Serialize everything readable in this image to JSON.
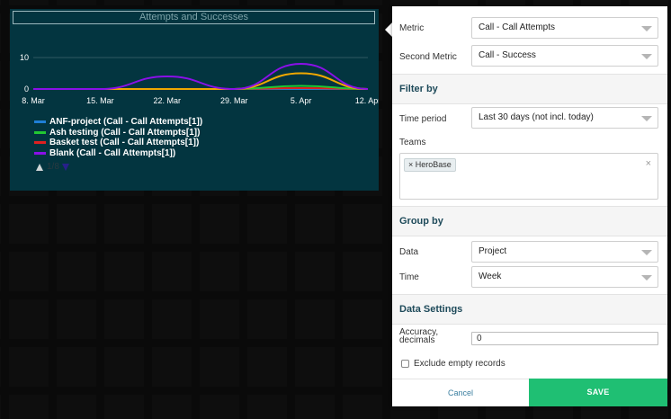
{
  "chart_widget": {
    "title": "Attempts and Successes",
    "pager_text": "1/8"
  },
  "chart_data": {
    "type": "line",
    "title": "Attempts and Successes",
    "x": [
      "8. Mar",
      "15. Mar",
      "22. Mar",
      "29. Mar",
      "5. Apr",
      "12. Apr"
    ],
    "x_dates": [
      "2021-03-08",
      "2021-03-15",
      "2021-03-22",
      "2021-03-29",
      "2021-04-05",
      "2021-04-12"
    ],
    "yticks": [
      "0",
      "10"
    ],
    "ylim": [
      0,
      14
    ],
    "grid": "horizontal",
    "series": [
      {
        "name": "ANF-project (Call - Call Attempts[1])",
        "color": "#1f7fd6",
        "points": [
          [
            0,
            0
          ],
          [
            1,
            0
          ],
          [
            2,
            0
          ],
          [
            3,
            0
          ],
          [
            4,
            0
          ],
          [
            5,
            0
          ]
        ]
      },
      {
        "name": "Ash testing (Call - Call Attempts[1])",
        "color": "#22c832",
        "points": [
          [
            0,
            0
          ],
          [
            1,
            0
          ],
          [
            2,
            0
          ],
          [
            3,
            0
          ],
          [
            4,
            1
          ],
          [
            5,
            0
          ]
        ]
      },
      {
        "name": "Basket test (Call - Call Attempts[1])",
        "color": "#e02020",
        "points": [
          [
            0,
            0
          ],
          [
            1,
            0
          ],
          [
            2,
            0
          ],
          [
            3,
            0
          ],
          [
            4,
            0.3
          ],
          [
            5,
            0
          ]
        ]
      },
      {
        "name": "Blank (Call - Call Attempts[1])",
        "color": "#8a10e8",
        "points": [
          [
            0,
            0
          ],
          [
            1,
            0
          ],
          [
            2,
            4
          ],
          [
            3,
            0
          ],
          [
            4,
            8
          ],
          [
            5,
            0
          ]
        ]
      },
      {
        "name": "",
        "color": "#f0a800",
        "points": [
          [
            0,
            0
          ],
          [
            1,
            0
          ],
          [
            2,
            0
          ],
          [
            3,
            0
          ],
          [
            4,
            5
          ],
          [
            5,
            0
          ]
        ]
      }
    ],
    "legend_placement": "bottom-left"
  },
  "panel": {
    "metric_label": "Metric",
    "metric_value": "Call - Call Attempts",
    "second_metric_label": "Second Metric",
    "second_metric_value": "Call - Success",
    "filter_by_title": "Filter by",
    "time_period_label": "Time period",
    "time_period_value": "Last 30 days (not incl. today)",
    "teams_label": "Teams",
    "team_tag": "× HeroBase",
    "teams_clear": "×",
    "group_by_title": "Group by",
    "data_label": "Data",
    "data_value": "Project",
    "time_label": "Time",
    "time_value": "Week",
    "data_settings_title": "Data Settings",
    "accuracy_label": "Accuracy, decimals",
    "accuracy_value": "0",
    "exclude_label": "Exclude empty records",
    "exclude_checked": false,
    "cancel_label": "Cancel",
    "save_label": "SAVE"
  },
  "colors": {
    "widget_bg": "#033540",
    "save_green": "#1fbf73",
    "section_title": "#1e4a5a"
  }
}
